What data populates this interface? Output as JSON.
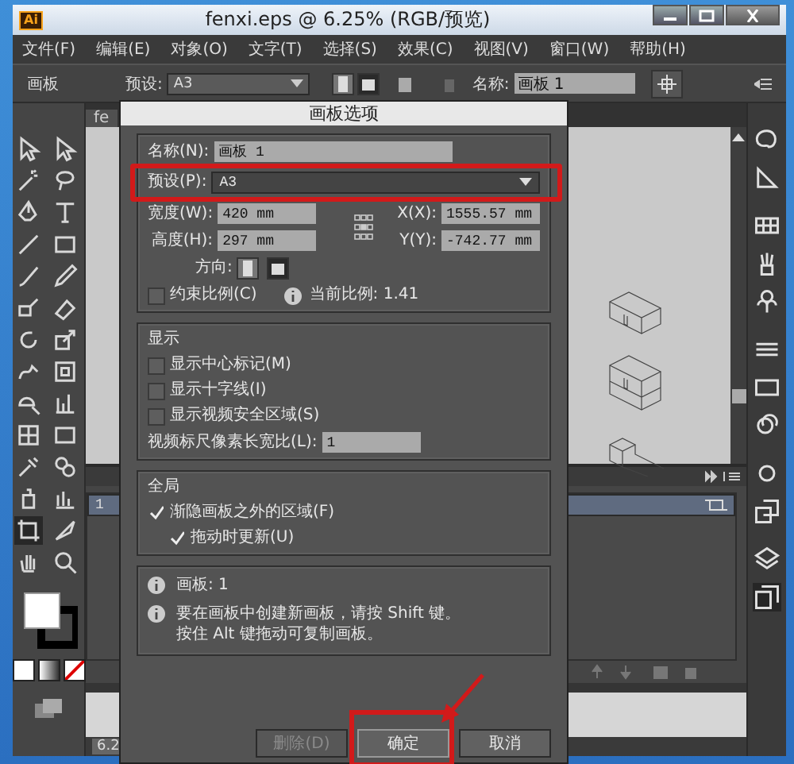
{
  "window": {
    "app_icon": "Ai",
    "title": "fenxi.eps @ 6.25% (RGB/预览)"
  },
  "menu": [
    "文件(F)",
    "编辑(E)",
    "对象(O)",
    "文字(T)",
    "选择(S)",
    "效果(C)",
    "视图(V)",
    "窗口(W)",
    "帮助(H)"
  ],
  "control_bar": {
    "label": "画板",
    "preset_label": "预设:",
    "preset_value": "A3",
    "orientation": [
      {
        "selected": false
      },
      {
        "selected": true
      }
    ],
    "name_label": "名称:",
    "name_value": "画板 1"
  },
  "document_tab": "fe",
  "artboards_panel": {
    "rows": [
      {
        "number": "1",
        "selected": true
      }
    ]
  },
  "status_bar": {
    "zoom": "6.2"
  },
  "dialog": {
    "title": "画板选项",
    "name_label": "名称(N):",
    "name_value": "画板 1",
    "preset_label": "预设(P):",
    "preset_value": "A3",
    "width_label": "宽度(W):",
    "width_value": "420 mm",
    "height_label": "高度(H):",
    "height_value": "297 mm",
    "x_label": "X(X):",
    "x_value": "1555.57 mm",
    "y_label": "Y(Y):",
    "y_value": "-742.77 mm",
    "orientation_label": "方向:",
    "orientation": [
      {
        "selected": false
      },
      {
        "selected": true
      }
    ],
    "constrain": {
      "label": "约束比例(C)",
      "checked": false
    },
    "ratio": "当前比例: 1.41",
    "display": {
      "title": "显示",
      "options": [
        {
          "label": "显示中心标记(M)",
          "checked": false
        },
        {
          "label": "显示十字线(I)",
          "checked": false
        },
        {
          "label": "显示视频安全区域(S)",
          "checked": false
        }
      ],
      "aspect_label": "视频标尺像素长宽比(L):",
      "aspect_value": "1"
    },
    "global": {
      "title": "全局",
      "options": [
        {
          "label": "渐隐画板之外的区域(F)",
          "checked": true,
          "children": [
            {
              "label": "拖动时更新(U)",
              "checked": true
            }
          ]
        }
      ]
    },
    "info": [
      {
        "lines": [
          "画板: 1"
        ]
      },
      {
        "lines": [
          "要在画板中创建新画板，请按 Shift 键。",
          "按住 Alt 键拖动可复制画板。"
        ]
      }
    ],
    "buttons": [
      {
        "label": "删除(D)",
        "disabled": true,
        "default": false
      },
      {
        "label": "确定",
        "disabled": false,
        "default": true
      },
      {
        "label": "取消",
        "disabled": false,
        "default": false
      }
    ]
  }
}
